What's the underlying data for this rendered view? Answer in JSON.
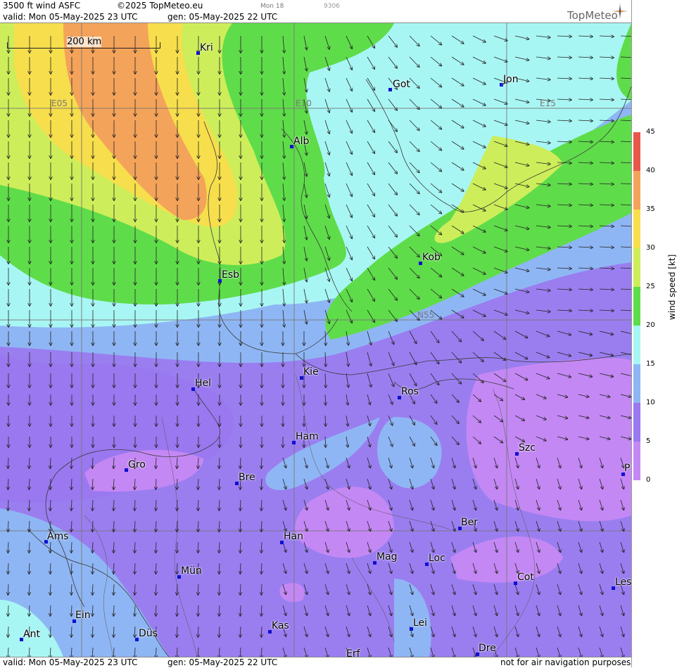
{
  "header": {
    "product": "3500 ft wind ASFC",
    "copyright": "©2025 TopMeteo.eu",
    "valid": "valid:  Mon  05-May-2025  23 UTC",
    "gen": "gen: 05-May-2025 22 UTC",
    "small_day": "Mon 18",
    "small_code": "9306",
    "logo": "TopMeteo"
  },
  "footer": {
    "valid": "valid:  Mon  05-May-2025  23 UTC",
    "gen": "gen: 05-May-2025 22 UTC",
    "disclaimer": "not for air navigation purposes"
  },
  "scale": {
    "label": "200 km"
  },
  "grid_labels": {
    "e05": "E05",
    "e10": "E10",
    "e15": "E15",
    "n55": "N55"
  },
  "cities": [
    {
      "id": "kri",
      "name": "Kri"
    },
    {
      "id": "got",
      "name": "Got"
    },
    {
      "id": "jon",
      "name": "Jon"
    },
    {
      "id": "alb",
      "name": "Alb"
    },
    {
      "id": "esb",
      "name": "Esb"
    },
    {
      "id": "kob",
      "name": "Kob"
    },
    {
      "id": "kie",
      "name": "Kie"
    },
    {
      "id": "hel",
      "name": "Hel"
    },
    {
      "id": "ros",
      "name": "Ros"
    },
    {
      "id": "ham",
      "name": "Ham"
    },
    {
      "id": "szc",
      "name": "Szc"
    },
    {
      "id": "gro",
      "name": "Gro"
    },
    {
      "id": "bre",
      "name": "Bre"
    },
    {
      "id": "p",
      "name": "P"
    },
    {
      "id": "ber",
      "name": "Ber"
    },
    {
      "id": "ams",
      "name": "Ams"
    },
    {
      "id": "han",
      "name": "Han"
    },
    {
      "id": "mag",
      "name": "Mag"
    },
    {
      "id": "loc",
      "name": "Loc"
    },
    {
      "id": "mun",
      "name": "Mün"
    },
    {
      "id": "cot",
      "name": "Cot"
    },
    {
      "id": "les",
      "name": "Les"
    },
    {
      "id": "ein",
      "name": "Ein"
    },
    {
      "id": "kas",
      "name": "Kas"
    },
    {
      "id": "lei",
      "name": "Lei"
    },
    {
      "id": "ant",
      "name": "Ant"
    },
    {
      "id": "dus",
      "name": "Düs"
    },
    {
      "id": "dre",
      "name": "Dre"
    },
    {
      "id": "erf",
      "name": "Erf"
    }
  ],
  "legend": {
    "unit": "wind speed [kt]",
    "ticks": [
      "45",
      "40",
      "35",
      "30",
      "25",
      "20",
      "15",
      "10",
      "5",
      "0"
    ],
    "colors": [
      "#e8584a",
      "#f4a35a",
      "#f7de4c",
      "#cdee5a",
      "#5fdc4a",
      "#a8f6f4",
      "#8fb6f4",
      "#9a78f0",
      "#c488f4"
    ]
  }
}
